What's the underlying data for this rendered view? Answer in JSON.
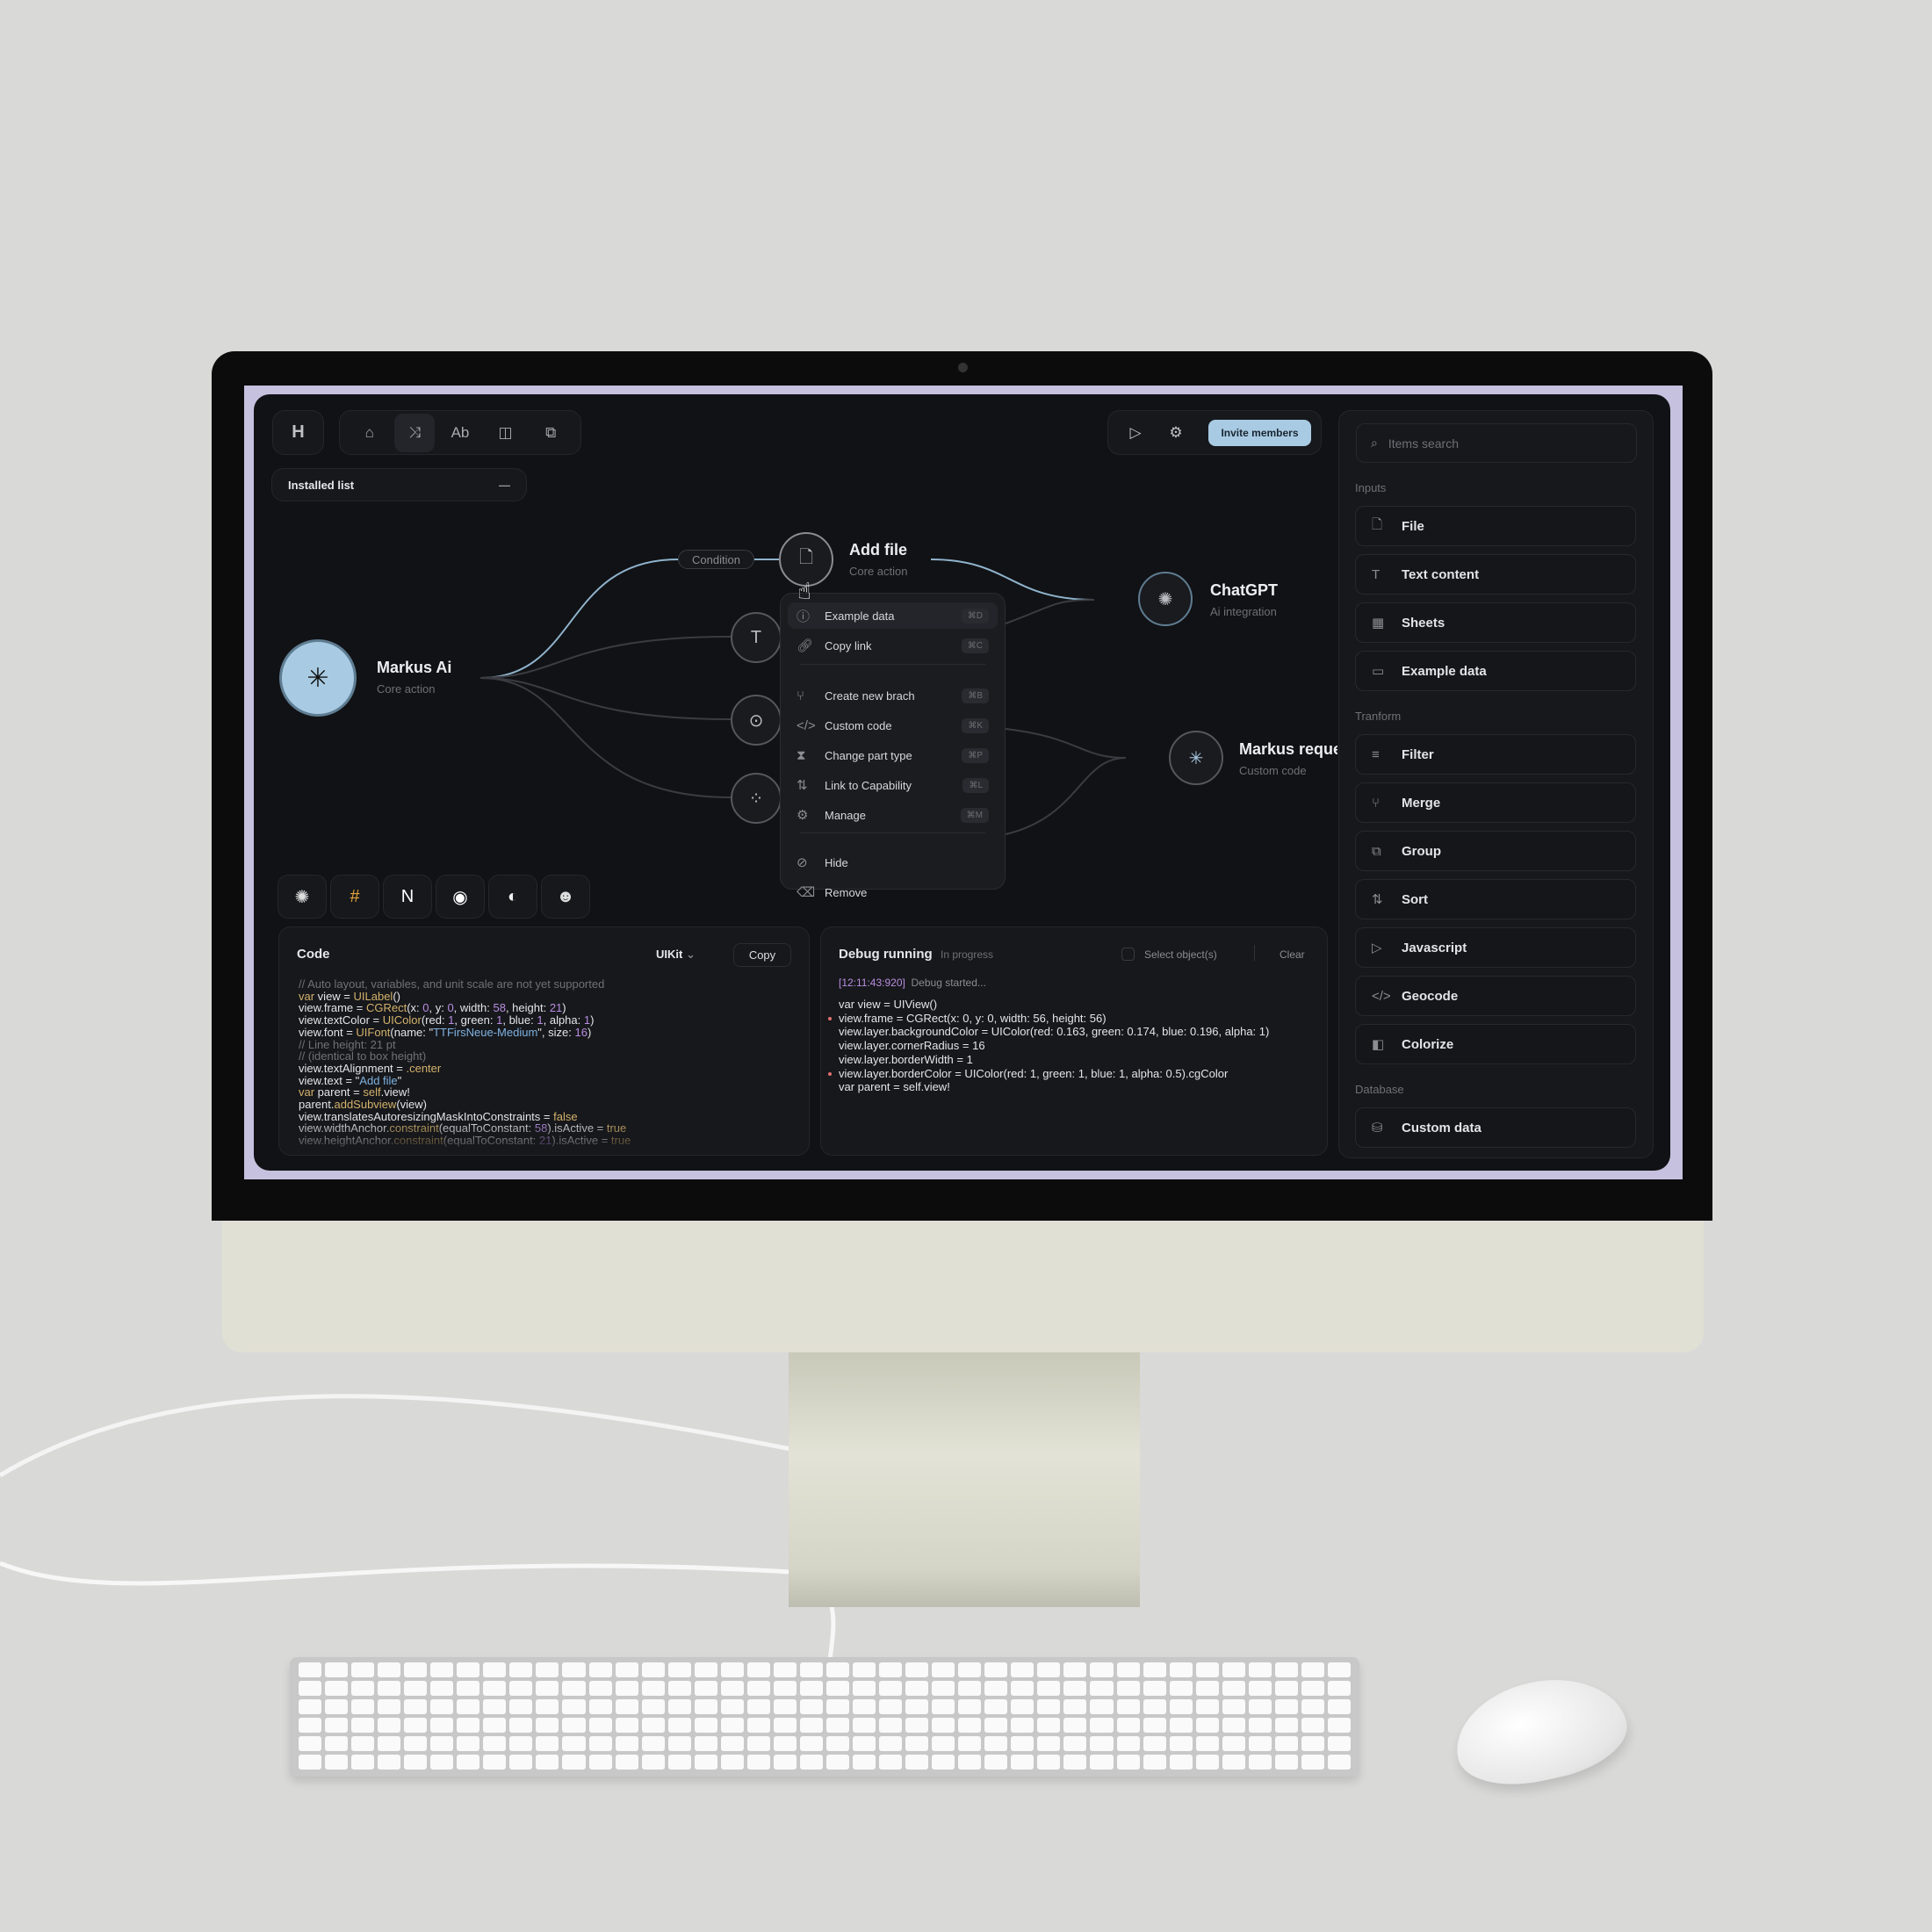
{
  "colors": {
    "accent": "#a8cbe3",
    "background": "#111215",
    "screen_frame": "#c6c1df"
  },
  "toolbar": {
    "logo": "H",
    "nav": [
      {
        "icon": "home-icon",
        "glyph": "⌂"
      },
      {
        "icon": "flow-icon",
        "glyph": "⤨",
        "active": true
      },
      {
        "icon": "text-style-icon",
        "glyph": "Ab"
      },
      {
        "icon": "book-icon",
        "glyph": "◫"
      },
      {
        "icon": "devices-icon",
        "glyph": "⧉"
      }
    ],
    "play_icon": "▷",
    "settings_icon": "⚙",
    "invite_label": "Invite members"
  },
  "installed_list": {
    "label": "Installed list",
    "collapse_icon": "—"
  },
  "canvas": {
    "condition_label": "Condition",
    "nodes": {
      "markus": {
        "title": "Markus Ai",
        "subtitle": "Core action"
      },
      "add_file": {
        "title": "Add file",
        "subtitle": "Core action"
      },
      "chatgpt": {
        "title": "ChatGPT",
        "subtitle": "Ai integration"
      },
      "markus_request": {
        "title": "Markus request",
        "subtitle": "Custom code"
      }
    },
    "text_node_glyph": "T"
  },
  "context_menu": {
    "items": [
      {
        "label": "Example data",
        "shortcut": "⌘D",
        "icon": "ⓘ",
        "name": "info-icon"
      },
      {
        "label": "Copy link",
        "shortcut": "⌘C",
        "icon": "🔗︎",
        "name": "link-icon"
      },
      {
        "label": "Create new brach",
        "shortcut": "⌘B",
        "icon": "⑂",
        "name": "branch-icon"
      },
      {
        "label": "Custom code",
        "shortcut": "⌘K",
        "icon": "</>",
        "name": "code-icon"
      },
      {
        "label": "Change part type",
        "shortcut": "⌘P",
        "icon": "⧗",
        "name": "hourglass-icon"
      },
      {
        "label": "Link to Capability",
        "shortcut": "⌘L",
        "icon": "⇅",
        "name": "swap-icon"
      },
      {
        "label": "Manage",
        "shortcut": "⌘M",
        "icon": "⚙",
        "name": "chip-icon"
      },
      {
        "label": "Hide",
        "shortcut": "",
        "icon": "⊘",
        "name": "eye-off-icon"
      },
      {
        "label": "Remove",
        "shortcut": "",
        "icon": "⌫",
        "name": "remove-icon"
      }
    ]
  },
  "integrations": [
    {
      "name": "openai-icon",
      "glyph": "✺"
    },
    {
      "name": "slack-icon",
      "glyph": "#"
    },
    {
      "name": "notion-icon",
      "glyph": "N"
    },
    {
      "name": "discord-icon",
      "glyph": "◉"
    },
    {
      "name": "linear-icon",
      "glyph": "◐"
    },
    {
      "name": "mailchimp-icon",
      "glyph": "☻"
    }
  ],
  "code_panel": {
    "title": "Code",
    "framework": "UIKit",
    "copy_label": "Copy",
    "lines": [
      [
        [
          "// Auto layout, variables, and unit scale are not yet supported",
          "com"
        ]
      ],
      [
        [
          "var",
          "kw"
        ],
        [
          " view = ",
          ""
        ],
        [
          "UILabel",
          "kw"
        ],
        [
          "()",
          ""
        ]
      ],
      [
        [
          "view.frame = ",
          ""
        ],
        [
          "CGRect",
          "kw"
        ],
        [
          "(x: ",
          ""
        ],
        [
          "0",
          "num"
        ],
        [
          ", y: ",
          ""
        ],
        [
          "0",
          "num"
        ],
        [
          ", width: ",
          ""
        ],
        [
          "58",
          "num"
        ],
        [
          ", height: ",
          ""
        ],
        [
          "21",
          "num"
        ],
        [
          ")",
          ""
        ]
      ],
      [
        [
          "view.textColor = ",
          ""
        ],
        [
          "UIColor",
          "kw"
        ],
        [
          "(red: ",
          ""
        ],
        [
          "1",
          "num"
        ],
        [
          ", green: ",
          ""
        ],
        [
          "1",
          "num"
        ],
        [
          ", blue: ",
          ""
        ],
        [
          "1",
          "num"
        ],
        [
          ", alpha: ",
          ""
        ],
        [
          "1",
          "num"
        ],
        [
          ")",
          ""
        ]
      ],
      [
        [
          "view.font = ",
          ""
        ],
        [
          "UIFont",
          "kw"
        ],
        [
          "(name: \"",
          ""
        ],
        [
          "TTFirsNeue-Medium",
          "str"
        ],
        [
          "\", size: ",
          ""
        ],
        [
          "16",
          "num"
        ],
        [
          ")",
          ""
        ]
      ],
      [
        [
          "// Line height: 21 pt",
          "com"
        ]
      ],
      [
        [
          "// (identical to box height)",
          "com"
        ]
      ],
      [
        [
          "view.textAlignment = ",
          ""
        ],
        [
          ".center",
          "kw"
        ]
      ],
      [
        [
          "view.text = \"",
          ""
        ],
        [
          "Add file",
          "str"
        ],
        [
          "\"",
          ""
        ]
      ],
      [
        [
          "var",
          "kw"
        ],
        [
          " parent = ",
          ""
        ],
        [
          "self",
          "kw"
        ],
        [
          ".view!",
          ""
        ]
      ],
      [
        [
          "parent.",
          ""
        ],
        [
          "addSubview",
          "kw"
        ],
        [
          "(view)",
          ""
        ]
      ],
      [
        [
          "view.translatesAutoresizingMaskIntoConstraints = ",
          ""
        ],
        [
          "false",
          "kw"
        ]
      ],
      [
        [
          "view.widthAnchor.",
          ""
        ],
        [
          "constraint",
          "kw"
        ],
        [
          "(equalToConstant: ",
          ""
        ],
        [
          "58",
          "num"
        ],
        [
          ").isActive = ",
          ""
        ],
        [
          "true",
          "kw"
        ]
      ],
      [
        [
          "view.heightAnchor.",
          ""
        ],
        [
          "constraint",
          "kw"
        ],
        [
          "(equalToConstant: ",
          ""
        ],
        [
          "21",
          "num"
        ],
        [
          ").isActive = ",
          ""
        ],
        [
          "true",
          "kw"
        ]
      ]
    ]
  },
  "debug_panel": {
    "title": "Debug running",
    "status": "In progress",
    "select_label": "Select object(s)",
    "clear_label": "Clear",
    "timestamp": "[12:11:43:920]",
    "started": "Debug started...",
    "lines": [
      {
        "text": "var view = UIView()",
        "marker": false
      },
      {
        "text": "view.frame = CGRect(x: 0, y: 0, width: 56, height: 56)",
        "marker": true
      },
      {
        "text": "view.layer.backgroundColor = UIColor(red: 0.163, green: 0.174, blue: 0.196, alpha: 1)",
        "marker": false
      },
      {
        "text": "view.layer.cornerRadius = 16",
        "marker": false
      },
      {
        "text": "view.layer.borderWidth = 1",
        "marker": false
      },
      {
        "text": "view.layer.borderColor = UIColor(red: 1, green: 1, blue: 1, alpha: 0.5).cgColor",
        "marker": true
      },
      {
        "text": "var parent = self.view!",
        "marker": false
      }
    ]
  },
  "right_panel": {
    "search_placeholder": "Items search",
    "sections": [
      {
        "label": "Inputs",
        "items": [
          {
            "label": "File",
            "icon": "🗋︎",
            "name": "file-icon"
          },
          {
            "label": "Text content",
            "icon": "T",
            "name": "text-icon"
          },
          {
            "label": "Sheets",
            "icon": "▦",
            "name": "table-icon"
          },
          {
            "label": "Example data",
            "icon": "▭",
            "name": "calendar-icon"
          }
        ]
      },
      {
        "label": "Tranform",
        "items": [
          {
            "label": "Filter",
            "icon": "≡",
            "name": "filter-icon"
          },
          {
            "label": "Merge",
            "icon": "⑂",
            "name": "merge-icon"
          },
          {
            "label": "Group",
            "icon": "⧉",
            "name": "group-icon"
          },
          {
            "label": "Sort",
            "icon": "⇅",
            "name": "sort-icon"
          },
          {
            "label": "Javascript",
            "icon": "▷",
            "name": "javascript-icon"
          },
          {
            "label": "Geocode",
            "icon": "</>",
            "name": "code-icon"
          },
          {
            "label": "Colorize",
            "icon": "◧",
            "name": "colorize-icon"
          }
        ]
      },
      {
        "label": "Database",
        "items": [
          {
            "label": "Custom data",
            "icon": "⛁",
            "name": "database-icon"
          }
        ]
      }
    ]
  }
}
